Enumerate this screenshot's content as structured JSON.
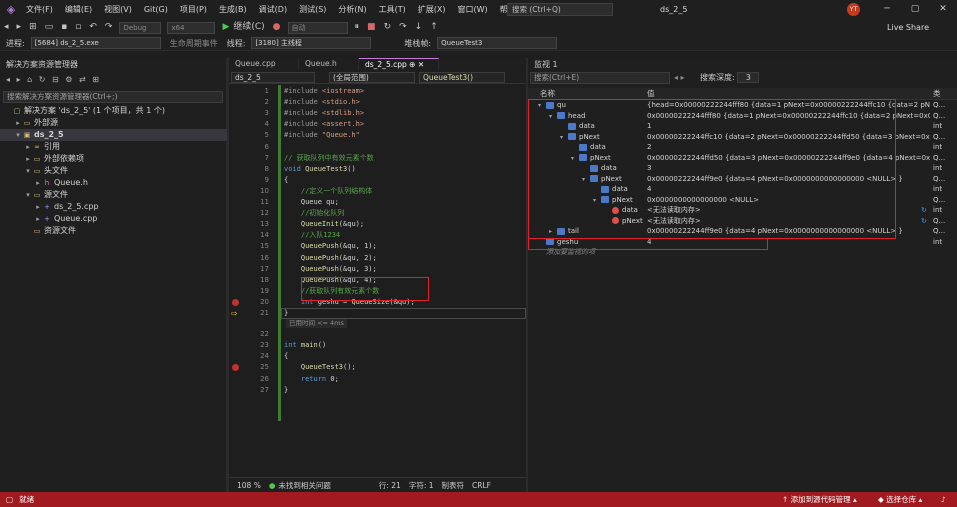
{
  "menu": {
    "items": [
      "文件(F)",
      "编辑(E)",
      "视图(V)",
      "Git(G)",
      "项目(P)",
      "生成(B)",
      "调试(D)",
      "测试(S)",
      "分析(N)",
      "工具(T)",
      "扩展(X)",
      "窗口(W)",
      "帮助(H)"
    ],
    "search": "搜索 (Ctrl+Q)",
    "solution": "ds_2_5",
    "avatar": "YT"
  },
  "toolbar": {
    "config": "Debug",
    "platform": "x64",
    "continue": "继续(C)",
    "auto": "自动",
    "live_share": "Live Share"
  },
  "procbar": {
    "process_label": "进程:",
    "process": "[5684] ds_2_5.exe",
    "lifecycle": "生命周期事件",
    "thread_label": "线程:",
    "thread": "[3180] 主线程",
    "stack_label": "堆栈帧:",
    "stack": "QueueTest3"
  },
  "solution_explorer": {
    "title": "解决方案资源管理器",
    "search": "搜索解决方案资源管理器(Ctrl+;)",
    "items": [
      {
        "label": "解决方案 'ds_2_5' (1 个项目，共 1 个)",
        "indent": 0,
        "arrow": "",
        "icon": "▢"
      },
      {
        "label": "外部源",
        "indent": 1,
        "arrow": "▸",
        "icon": "▭"
      },
      {
        "label": "ds_2_5",
        "indent": 1,
        "arrow": "▾",
        "icon": "▣",
        "bold": true
      },
      {
        "label": "引用",
        "indent": 2,
        "arrow": "▸",
        "icon": "∞"
      },
      {
        "label": "外部依赖项",
        "indent": 2,
        "arrow": "▸",
        "icon": "▭"
      },
      {
        "label": "头文件",
        "indent": 2,
        "arrow": "▾",
        "icon": "▭"
      },
      {
        "label": "Queue.h",
        "indent": 3,
        "arrow": "▸",
        "icon": "h"
      },
      {
        "label": "源文件",
        "indent": 2,
        "arrow": "▾",
        "icon": "▭"
      },
      {
        "label": "ds_2_5.cpp",
        "indent": 3,
        "arrow": "▸",
        "icon": "+"
      },
      {
        "label": "Queue.cpp",
        "indent": 3,
        "arrow": "▸",
        "icon": "+"
      },
      {
        "label": "资源文件",
        "indent": 2,
        "arrow": "",
        "icon": "▭"
      }
    ]
  },
  "editor": {
    "tabs": [
      "Queue.cpp",
      "Queue.h",
      "ds_2_5.cpp"
    ],
    "nav": [
      "ds_2_5",
      "(全局范围)",
      "QueueTest3()"
    ],
    "lines": [
      {
        "n": "1",
        "t": "#include <iostream>"
      },
      {
        "n": "2",
        "t": "#include <stdio.h>"
      },
      {
        "n": "3",
        "t": "#include <stdlib.h>"
      },
      {
        "n": "4",
        "t": "#include <assert.h>"
      },
      {
        "n": "5",
        "t": "#include \"Queue.h\""
      },
      {
        "n": "6",
        "t": ""
      },
      {
        "n": "7",
        "t": "// 获取队列中有效元素个数"
      },
      {
        "n": "8",
        "t": "void QueueTest3()"
      },
      {
        "n": "9",
        "t": "{"
      },
      {
        "n": "10",
        "t": "    //定义一个队列结构体"
      },
      {
        "n": "11",
        "t": "    Queue qu;"
      },
      {
        "n": "12",
        "t": "    //初始化队列"
      },
      {
        "n": "13",
        "t": "    QueueInit(&qu);"
      },
      {
        "n": "14",
        "t": "    //入队1234"
      },
      {
        "n": "15",
        "t": "    QueuePush(&qu, 1);"
      },
      {
        "n": "16",
        "t": "    QueuePush(&qu, 2);"
      },
      {
        "n": "17",
        "t": "    QueuePush(&qu, 3);"
      },
      {
        "n": "18",
        "t": "    QueuePush(&qu, 4);"
      },
      {
        "n": "19",
        "t": "    //获取队列有效元素个数"
      },
      {
        "n": "20",
        "t": "    int geshu = QueueSize(&qu);"
      },
      {
        "n": "21",
        "t": "}"
      },
      {
        "n": "22",
        "t": ""
      },
      {
        "n": "23",
        "t": "int main()"
      },
      {
        "n": "24",
        "t": "{"
      },
      {
        "n": "25",
        "t": "    QueueTest3();"
      },
      {
        "n": "26",
        "t": "    return 0;"
      },
      {
        "n": "27",
        "t": "}"
      }
    ],
    "hint": "已用时间 <= 4ms",
    "status": {
      "zoom": "108 %",
      "issues": "未找到相关问题",
      "line": "行: 21",
      "col": "字符: 1",
      "mode": "制表符",
      "eol": "CRLF"
    }
  },
  "watch": {
    "title": "监视 1",
    "search": "搜索(Ctrl+E)",
    "depth_label": "搜索深度:",
    "depth": "3",
    "headers": [
      "名称",
      "值",
      "类"
    ],
    "rows": [
      {
        "name": "qu",
        "value": "{head=0x00000222244fff80 {data=1 pNext=0x00000222244ffc10 {data=2 pNext=0x...",
        "type": "Q...",
        "indent": 0,
        "exp": "▾",
        "icon": "obj"
      },
      {
        "name": "head",
        "value": "0x00000222244fff80 {data=1 pNext=0x00000222244ffc10 {data=2 pNext=0x000002...",
        "type": "Q...",
        "indent": 1,
        "exp": "▾",
        "icon": "obj"
      },
      {
        "name": "data",
        "value": "1",
        "type": "int",
        "indent": 2,
        "exp": "",
        "icon": "obj"
      },
      {
        "name": "pNext",
        "value": "0x00000222244ffc10 {data=2 pNext=0x00000222244ffd50 {data=3 pNext=0x00000...",
        "type": "Q...",
        "indent": 2,
        "exp": "▾",
        "icon": "obj"
      },
      {
        "name": "data",
        "value": "2",
        "type": "int",
        "indent": 3,
        "exp": "",
        "icon": "obj"
      },
      {
        "name": "pNext",
        "value": "0x00000222244ffd50 {data=3 pNext=0x00000222244ff9e0 {data=4 pNext=0x000000...",
        "type": "Q...",
        "indent": 3,
        "exp": "▾",
        "icon": "obj"
      },
      {
        "name": "data",
        "value": "3",
        "type": "int",
        "indent": 4,
        "exp": "",
        "icon": "obj"
      },
      {
        "name": "pNext",
        "value": "0x00000222244ff9e0 {data=4 pNext=0x0000000000000000 <NULL> }",
        "type": "Q...",
        "indent": 4,
        "exp": "▾",
        "icon": "obj"
      },
      {
        "name": "data",
        "value": "4",
        "type": "int",
        "indent": 5,
        "exp": "",
        "icon": "obj"
      },
      {
        "name": "pNext",
        "value": "0x0000000000000000 <NULL>",
        "type": "Q...",
        "indent": 5,
        "exp": "▾",
        "icon": "obj"
      },
      {
        "name": "data",
        "value": "<无法读取内存>",
        "type": "int",
        "indent": 6,
        "exp": "",
        "icon": "err"
      },
      {
        "name": "pNext",
        "value": "<无法读取内存>",
        "type": "Q...",
        "indent": 6,
        "exp": "",
        "icon": "err"
      },
      {
        "name": "tail",
        "value": "0x00000222244ff9e0 {data=4 pNext=0x0000000000000000 <NULL> }",
        "type": "Q...",
        "indent": 1,
        "exp": "▸",
        "icon": "obj"
      },
      {
        "name": "geshu",
        "value": "4",
        "type": "int",
        "indent": 0,
        "exp": "",
        "icon": "obj"
      },
      {
        "name": "添加要监视的项",
        "value": "",
        "type": "",
        "indent": 0,
        "exp": "",
        "icon": "none"
      }
    ]
  },
  "statusbar": {
    "ready": "就绪",
    "add_source": "添加到源代码管理",
    "select_repo": "选择仓库"
  }
}
